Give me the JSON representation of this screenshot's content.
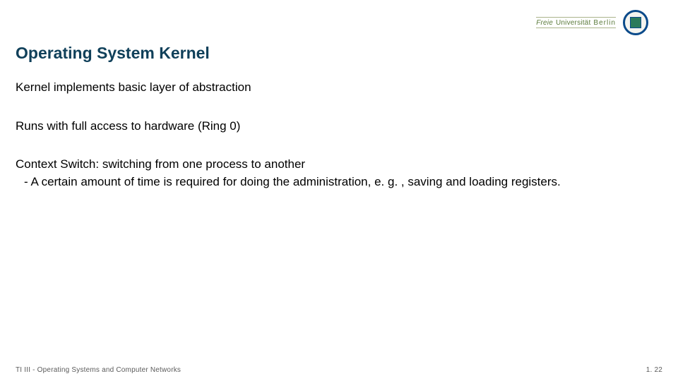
{
  "logo": {
    "word1": "Freie",
    "word2": "Universität",
    "word3": "Berlin"
  },
  "title": "Operating System Kernel",
  "body": {
    "p1": "Kernel implements basic layer of abstraction",
    "p2": "Runs with full access to hardware (Ring 0)",
    "p3_line1": "Context Switch: switching from one process to another",
    "p3_line2": "- A certain amount of time is required for doing the administration, e. g. , saving and loading registers."
  },
  "footer": {
    "left": "TI III - Operating Systems and Computer Networks",
    "right": "1. 22"
  }
}
